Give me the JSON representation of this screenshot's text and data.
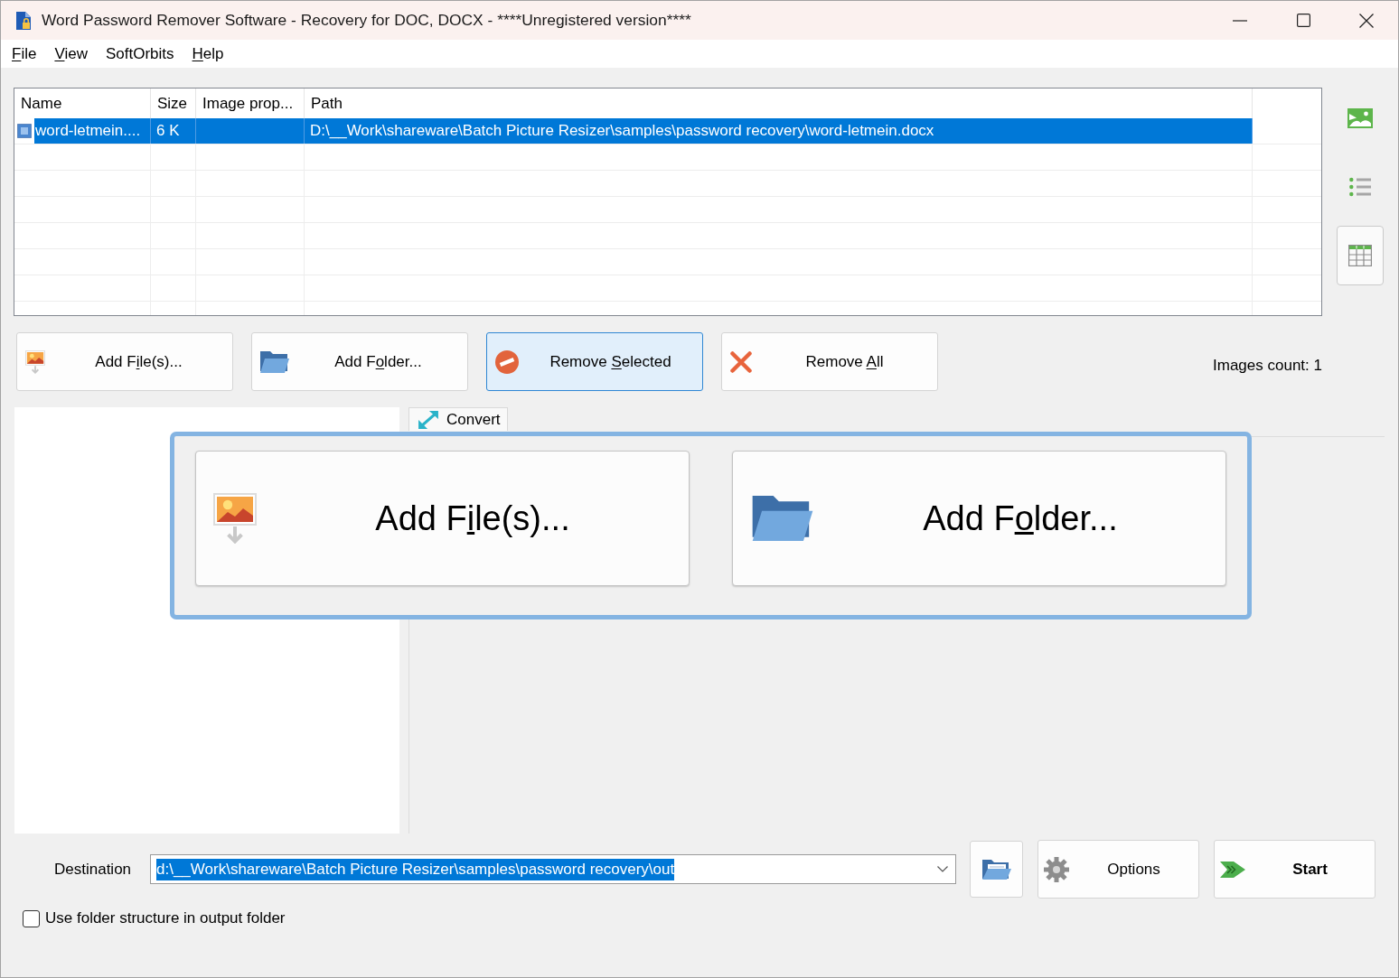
{
  "window": {
    "title": "Word Password Remover Software - Recovery for DOC, DOCX - ****Unregistered version****"
  },
  "menu": [
    {
      "label": [
        {
          "text": "F",
          "underlined": true
        },
        {
          "text": "ile",
          "underlined": false
        }
      ]
    },
    {
      "label": [
        {
          "text": "V",
          "underlined": true
        },
        {
          "text": "iew",
          "underlined": false
        }
      ]
    },
    {
      "label": [
        {
          "text": "SoftOrbits",
          "underlined": false
        }
      ]
    },
    {
      "label": [
        {
          "text": "H",
          "underlined": true
        },
        {
          "text": "elp",
          "underlined": false
        }
      ]
    }
  ],
  "file_table": {
    "columns": [
      {
        "label": "Name"
      },
      {
        "label": "Size"
      },
      {
        "label": "Image prop..."
      },
      {
        "label": "Path"
      }
    ],
    "rows": [
      {
        "selected": true,
        "name": "word-letmein....",
        "size": "6 K",
        "path": "D:\\__Work\\shareware\\Batch Picture Resizer\\samples\\password recovery\\word-letmein.docx"
      }
    ]
  },
  "view_toolbar": [
    {
      "kind": "thumbnails",
      "selected": false
    },
    {
      "kind": "list",
      "selected": false
    },
    {
      "kind": "details",
      "selected": true
    }
  ],
  "file_buttons": [
    {
      "kind": "add_files",
      "hovered": false,
      "label": [
        {
          "text": "Add F",
          "underlined": false
        },
        {
          "text": "i",
          "underlined": true
        },
        {
          "text": "le(s)...",
          "underlined": false
        }
      ]
    },
    {
      "kind": "add_folder",
      "hovered": false,
      "label": [
        {
          "text": "Add F",
          "underlined": false
        },
        {
          "text": "o",
          "underlined": true
        },
        {
          "text": "lder...",
          "underlined": false
        }
      ]
    },
    {
      "kind": "remove_selected",
      "hovered": true,
      "label": [
        {
          "text": "Remove ",
          "underlined": false
        },
        {
          "text": "S",
          "underlined": true
        },
        {
          "text": "elected",
          "underlined": false
        }
      ]
    },
    {
      "kind": "remove_all",
      "hovered": false,
      "label": [
        {
          "text": "Remove ",
          "underlined": false
        },
        {
          "text": "A",
          "underlined": true
        },
        {
          "text": "ll",
          "underlined": false
        }
      ]
    }
  ],
  "images_count": "Images count: 1",
  "tabs": [
    {
      "label": "Convert",
      "selected": true
    }
  ],
  "add_panel": {
    "buttons": [
      {
        "kind": "add_files",
        "label": [
          {
            "text": "Add F",
            "underlined": false
          },
          {
            "text": "i",
            "underlined": true
          },
          {
            "text": "le(s)...",
            "underlined": false
          }
        ]
      },
      {
        "kind": "add_folder",
        "label": [
          {
            "text": "Add F",
            "underlined": false
          },
          {
            "text": "o",
            "underlined": true
          },
          {
            "text": "lder...",
            "underlined": false
          }
        ]
      }
    ]
  },
  "destination": {
    "label": "Destination",
    "value": "d:\\__Work\\shareware\\Batch Picture Resizer\\samples\\password recovery\\out",
    "value_selected": true
  },
  "action_buttons": [
    {
      "kind": "browse"
    },
    {
      "kind": "options",
      "label": "Options"
    },
    {
      "kind": "start",
      "label": "Start"
    }
  ],
  "folder_structure_checkbox": {
    "label": "Use folder structure in output folder",
    "checked": false
  }
}
